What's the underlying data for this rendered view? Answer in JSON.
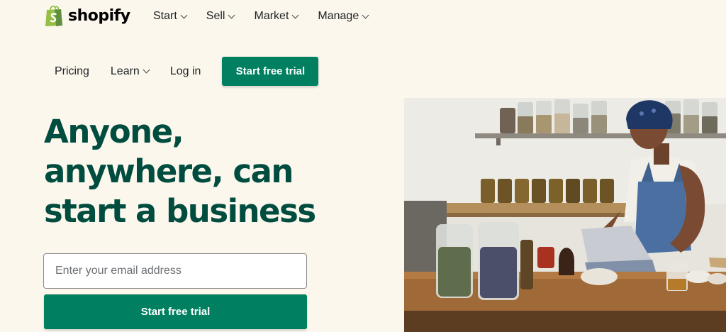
{
  "brand": {
    "name": "shopify",
    "color": "#95bf47"
  },
  "nav_top": [
    {
      "label": "Start"
    },
    {
      "label": "Sell"
    },
    {
      "label": "Market"
    },
    {
      "label": "Manage"
    }
  ],
  "nav_second": {
    "pricing": "Pricing",
    "learn": "Learn",
    "login": "Log in",
    "trial_button": "Start free trial"
  },
  "hero": {
    "headline_lines": [
      "Anyone,",
      "anywhere, can",
      "start a business"
    ],
    "email_placeholder": "Enter your email address",
    "cta": "Start free trial",
    "image_alt": "Woman working on a tablet at a wooden counter with jars of herbs"
  },
  "colors": {
    "accent": "#008060",
    "headline": "#004c3f",
    "background": "#fbf7ed"
  }
}
